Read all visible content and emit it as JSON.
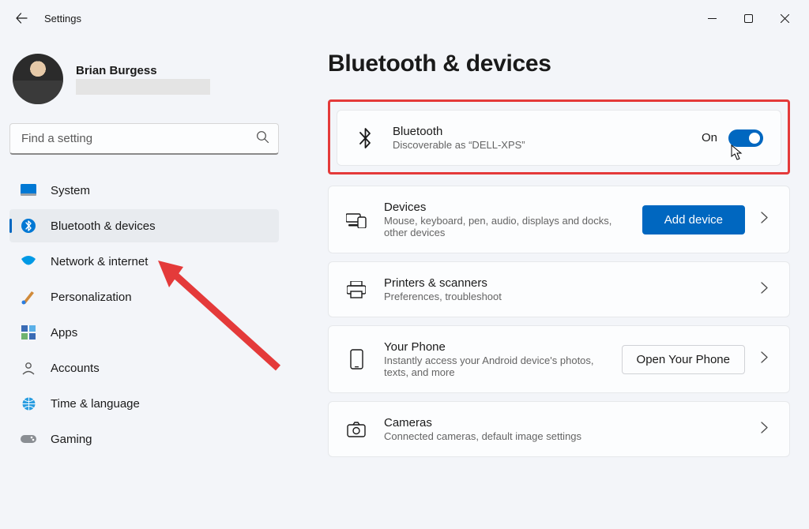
{
  "window": {
    "title": "Settings"
  },
  "profile": {
    "name": "Brian Burgess"
  },
  "search": {
    "placeholder": "Find a setting"
  },
  "sidebar": {
    "items": [
      {
        "label": "System"
      },
      {
        "label": "Bluetooth & devices"
      },
      {
        "label": "Network & internet"
      },
      {
        "label": "Personalization"
      },
      {
        "label": "Apps"
      },
      {
        "label": "Accounts"
      },
      {
        "label": "Time & language"
      },
      {
        "label": "Gaming"
      }
    ]
  },
  "page": {
    "title": "Bluetooth & devices"
  },
  "bluetooth": {
    "title": "Bluetooth",
    "subtitle": "Discoverable as “DELL-XPS”",
    "state_label": "On"
  },
  "devices": {
    "title": "Devices",
    "subtitle": "Mouse, keyboard, pen, audio, displays and docks, other devices",
    "button": "Add device"
  },
  "printers": {
    "title": "Printers & scanners",
    "subtitle": "Preferences, troubleshoot"
  },
  "phone": {
    "title": "Your Phone",
    "subtitle": "Instantly access your Android device's photos, texts, and more",
    "button": "Open Your Phone"
  },
  "cameras": {
    "title": "Cameras",
    "subtitle": "Connected cameras, default image settings"
  }
}
